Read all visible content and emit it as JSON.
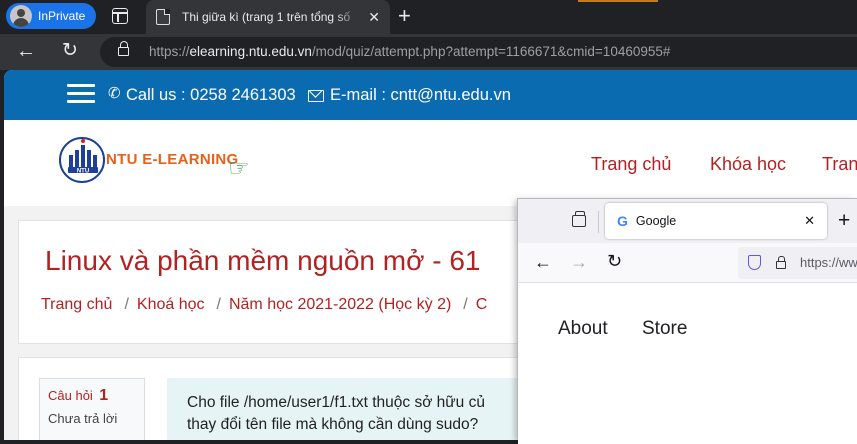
{
  "edge": {
    "profile_label": "InPrivate",
    "active_tab_title": "Thi giữa kì (trang 1 trên tổng số",
    "tab_close": "✕",
    "new_tab": "+",
    "url_prefix": "https://",
    "url_host": "elearning.ntu.edu.vn",
    "url_path": "/mod/quiz/attempt.php?attempt=1166671&cmid=10460955#"
  },
  "site": {
    "topbar": {
      "call_us": "Call us : 0258 2461303",
      "email": "E-mail : cntt@ntu.edu.vn"
    },
    "logo_text": "NTU E-LEARNING",
    "nav": [
      "Trang chủ",
      "Khóa học",
      "Trang"
    ],
    "course_title": "Linux và phần mềm nguồn mở - 61",
    "breadcrumb": [
      "Trang chủ",
      "Khoá học",
      "Năm học 2021-2022 (Học kỳ 2)",
      "C"
    ],
    "question": {
      "label": "Câu hỏi",
      "number": "1",
      "status": "Chưa trả lời",
      "text_line1": "Cho file /home/user1/f1.txt thuộc sở hữu củ",
      "text_line2": "thay đổi tên file mà không cần dùng sudo?"
    }
  },
  "firefox": {
    "tab_title": "Google",
    "tab_close": "✕",
    "new_tab": "+",
    "url": "https://ww",
    "links": [
      "About",
      "Store"
    ]
  },
  "colors": {
    "site_topbar": "#0b6bb0",
    "site_accent": "#b22222",
    "edge_inprivate": "#1a73e8"
  }
}
